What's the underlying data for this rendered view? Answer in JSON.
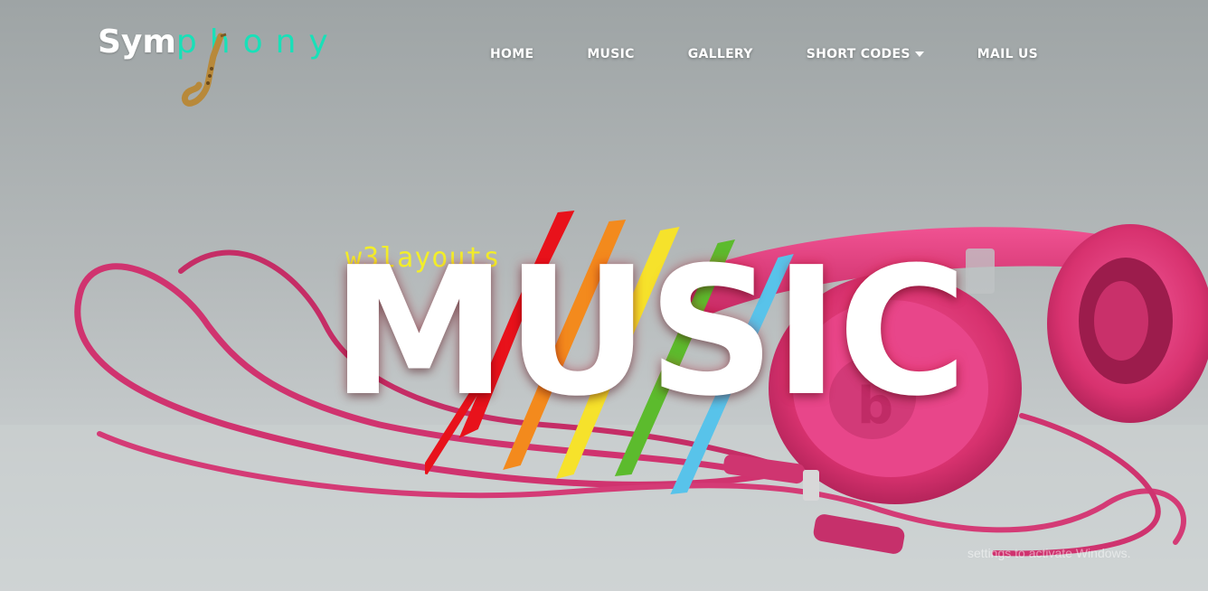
{
  "logo": {
    "part1": "Sym",
    "part2": "phony",
    "icon": "saxophone-icon"
  },
  "nav": {
    "home": "HOME",
    "music": "MUSIC",
    "gallery": "GALLERY",
    "short_codes": "SHORT CODES",
    "mail_us": "MAIL US"
  },
  "hero": {
    "tag": "w3layouts",
    "headline": "MUSIC",
    "background": "pink-headphones-image",
    "watermark": "settings to activate Windows."
  },
  "colors": {
    "logo_accent": "#19e0b8",
    "tag": "#f2ee2a",
    "headphones": "#e23d82",
    "paint": [
      "#e8121b",
      "#f38a1d",
      "#f6e22b",
      "#5cbb2d",
      "#58c3ea"
    ]
  }
}
